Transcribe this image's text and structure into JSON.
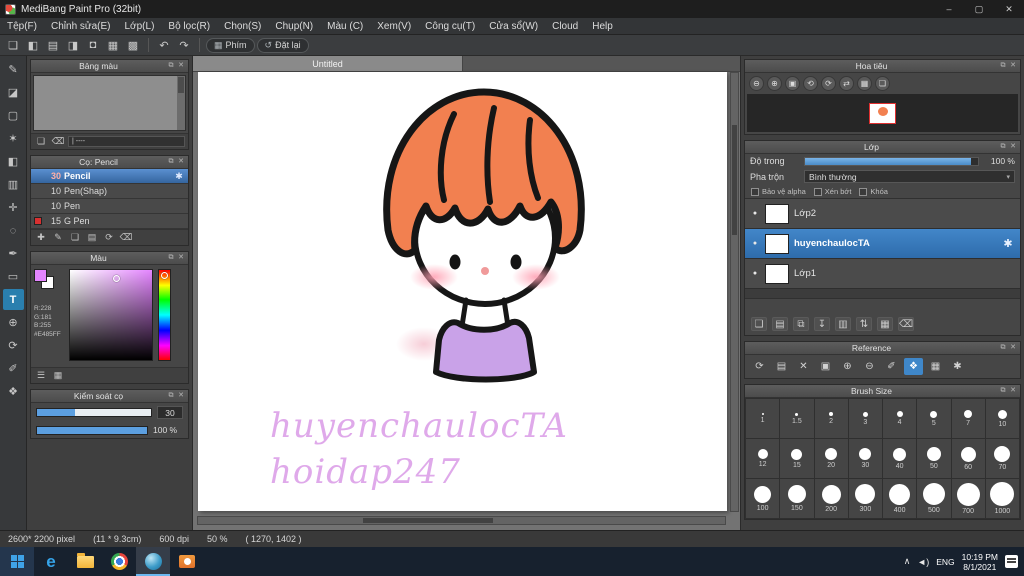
{
  "titlebar": {
    "title": "MediBang Paint Pro (32bit)",
    "minimize": "–",
    "maximize": "▢",
    "close": "✕"
  },
  "menubar": {
    "items": [
      "Tệp(F)",
      "Chỉnh sửa(E)",
      "Lớp(L)",
      "Bộ lọc(R)",
      "Chọn(S)",
      "Chụp(N)",
      "Màu (C)",
      "Xem(V)",
      "Công cụ(T)",
      "Cửa sổ(W)",
      "Cloud",
      "Help"
    ]
  },
  "toolbar": {
    "file_icons": [
      {
        "name": "new-canvas-icon",
        "glyph": "❏"
      },
      {
        "name": "save-icon",
        "glyph": "◧"
      },
      {
        "name": "open-icon",
        "glyph": "▤"
      },
      {
        "name": "export-icon",
        "glyph": "◨"
      },
      {
        "name": "comment-icon",
        "glyph": "◘"
      },
      {
        "name": "grid-icon",
        "glyph": "▦"
      },
      {
        "name": "material-icon",
        "glyph": "▩"
      }
    ],
    "undo_icon": "↶",
    "redo_icon": "↷",
    "keys_icon": "▦",
    "keys_label": "Phím",
    "reset_icon": "↺",
    "reset_label": "Đặt lại"
  },
  "left": {
    "tools": [
      {
        "name": "brush-tool-icon",
        "glyph": "✎"
      },
      {
        "name": "eraser-tool-icon",
        "glyph": "◪"
      },
      {
        "name": "select-tool-icon",
        "glyph": "▢"
      },
      {
        "name": "wand-tool-icon",
        "glyph": "✶"
      },
      {
        "name": "bucket-tool-icon",
        "glyph": "◧"
      },
      {
        "name": "gradient-tool-icon",
        "glyph": "▥"
      },
      {
        "name": "move-tool-icon",
        "glyph": "✛"
      },
      {
        "name": "lasso-tool-icon",
        "glyph": "◌"
      },
      {
        "name": "pen-tool-icon",
        "glyph": "✒"
      },
      {
        "name": "shape-tool-icon",
        "glyph": "▭"
      },
      {
        "name": "text-tool-icon",
        "glyph": "T",
        "active": true
      },
      {
        "name": "zoom-tool-icon",
        "glyph": "⊕"
      },
      {
        "name": "rotate-tool-icon",
        "glyph": "⟳"
      },
      {
        "name": "eyedropper-tool-icon",
        "glyph": "✐"
      },
      {
        "name": "hand-tool-icon",
        "glyph": "❖"
      }
    ],
    "palette": {
      "title": "Bảng màu",
      "divider_label": "| ----",
      "toolbar": [
        {
          "name": "add-color-icon",
          "glyph": "❏"
        },
        {
          "name": "delete-color-icon",
          "glyph": "⌫"
        }
      ]
    },
    "brush": {
      "title": "Cọ: Pencil",
      "gear_icon": "✱",
      "items": [
        {
          "size": "30",
          "name": "Pencil",
          "sel": true
        },
        {
          "size": "10",
          "name": "Pen(Shap)"
        },
        {
          "size": "10",
          "name": "Pen"
        },
        {
          "size": "15",
          "name": "G Pen",
          "swatch": "#d83030"
        }
      ],
      "toolbar": [
        {
          "name": "add-brush-icon",
          "glyph": "✚"
        },
        {
          "name": "edit-brush-icon",
          "glyph": "✎"
        },
        {
          "name": "duplicate-brush-icon",
          "glyph": "❏"
        },
        {
          "name": "brush-folder-icon",
          "glyph": "▤"
        },
        {
          "name": "sync-brush-icon",
          "glyph": "⟳"
        },
        {
          "name": "delete-brush-icon",
          "glyph": "⌫"
        }
      ]
    },
    "color": {
      "title": "Màu",
      "r": "R:228",
      "g": "G:181",
      "b": "B:255",
      "hex": "#E485FF",
      "foreground": "#E485FF",
      "toolbar": [
        {
          "name": "rgb-sliders-icon",
          "glyph": "☰"
        },
        {
          "name": "palette-grid-icon",
          "glyph": "▦"
        }
      ]
    },
    "control": {
      "title": "Kiểm soát cọ",
      "size_value": "30",
      "opacity_value": "100 %"
    }
  },
  "canvas": {
    "tab": "Untitled",
    "signature_line1": "huyenchaulocTA",
    "signature_line2": "hoidap247"
  },
  "right": {
    "navigator": {
      "title": "Hoa tiêu",
      "icons": [
        {
          "name": "nav-zoom-out-icon",
          "glyph": "⊖"
        },
        {
          "name": "nav-zoom-in-icon",
          "glyph": "⊕"
        },
        {
          "name": "nav-fit-view-icon",
          "glyph": "▣"
        },
        {
          "name": "nav-rotate-left-icon",
          "glyph": "⟲"
        },
        {
          "name": "nav-rotate-right-icon",
          "glyph": "⟳"
        },
        {
          "name": "nav-flip-icon",
          "glyph": "⇄"
        },
        {
          "name": "nav-grid-icon",
          "glyph": "▦"
        },
        {
          "name": "nav-snapshot-icon",
          "glyph": "❏"
        }
      ]
    },
    "layers": {
      "title": "Lớp",
      "opacity_label": "Độ trong",
      "opacity_value": "100 %",
      "blend_label": "Pha trộn",
      "blend_value": "Bình thường",
      "blend_arrow": "▾",
      "checkboxes": [
        "Bảo vệ alpha",
        "Xén bớt",
        "Khóa"
      ],
      "eye_icon": "●",
      "gear_icon": "✱",
      "items": [
        {
          "name": "Lớp2"
        },
        {
          "name": "huyenchaulocTA",
          "sel": true
        },
        {
          "name": "Lớp1"
        }
      ],
      "toolbar": [
        {
          "name": "add-layer-icon",
          "glyph": "❏"
        },
        {
          "name": "add-layer-folder-icon",
          "glyph": "▤"
        },
        {
          "name": "duplicate-layer-icon",
          "glyph": "⧉"
        },
        {
          "name": "merge-down-icon",
          "glyph": "↧"
        },
        {
          "name": "layer-folder-icon",
          "glyph": "▥"
        },
        {
          "name": "reorder-layers-icon",
          "glyph": "⇅"
        },
        {
          "name": "transfer-layer-icon",
          "glyph": "▦"
        },
        {
          "name": "delete-layer-icon",
          "glyph": "⌫"
        }
      ]
    },
    "reference": {
      "title": "Reference",
      "icons": [
        {
          "name": "ref-refresh-icon",
          "glyph": "⟳"
        },
        {
          "name": "ref-open-icon",
          "glyph": "▤"
        },
        {
          "name": "ref-close-icon",
          "glyph": "✕"
        },
        {
          "name": "ref-fit-icon",
          "glyph": "▣"
        },
        {
          "name": "ref-zoom-in-icon",
          "glyph": "⊕"
        },
        {
          "name": "ref-zoom-out-icon",
          "glyph": "⊖"
        },
        {
          "name": "ref-eyedropper-icon",
          "glyph": "✐"
        },
        {
          "name": "ref-hand-icon",
          "glyph": "❖",
          "active": true
        },
        {
          "name": "ref-grid-icon",
          "glyph": "▦"
        },
        {
          "name": "ref-settings-icon",
          "glyph": "✱"
        }
      ]
    },
    "brush_size": {
      "title": "Brush Size",
      "sizes": [
        "1",
        "1.5",
        "2",
        "3",
        "4",
        "5",
        "7",
        "10",
        "12",
        "15",
        "20",
        "30",
        "40",
        "50",
        "60",
        "70",
        "100",
        "150",
        "200",
        "300",
        "400",
        "500",
        "700",
        "1000"
      ]
    }
  },
  "statusbar": {
    "segments": [
      "2600* 2200 pixel",
      "(11 * 9.3cm)",
      "600 dpi",
      "50 %",
      "( 1270, 1402 )"
    ]
  },
  "taskbar": {
    "edge_glyph": "e",
    "tray_chevron": "∧",
    "tray_speaker": "◄)",
    "lang": "ENG",
    "time": "10:19 PM",
    "date": "8/1/2021"
  },
  "colors": {
    "accent_pink": "#E485FF",
    "hair_orange": "#f28050",
    "shirt_purple": "#c9a2e8",
    "selection_blue": "#3a7cc4"
  }
}
